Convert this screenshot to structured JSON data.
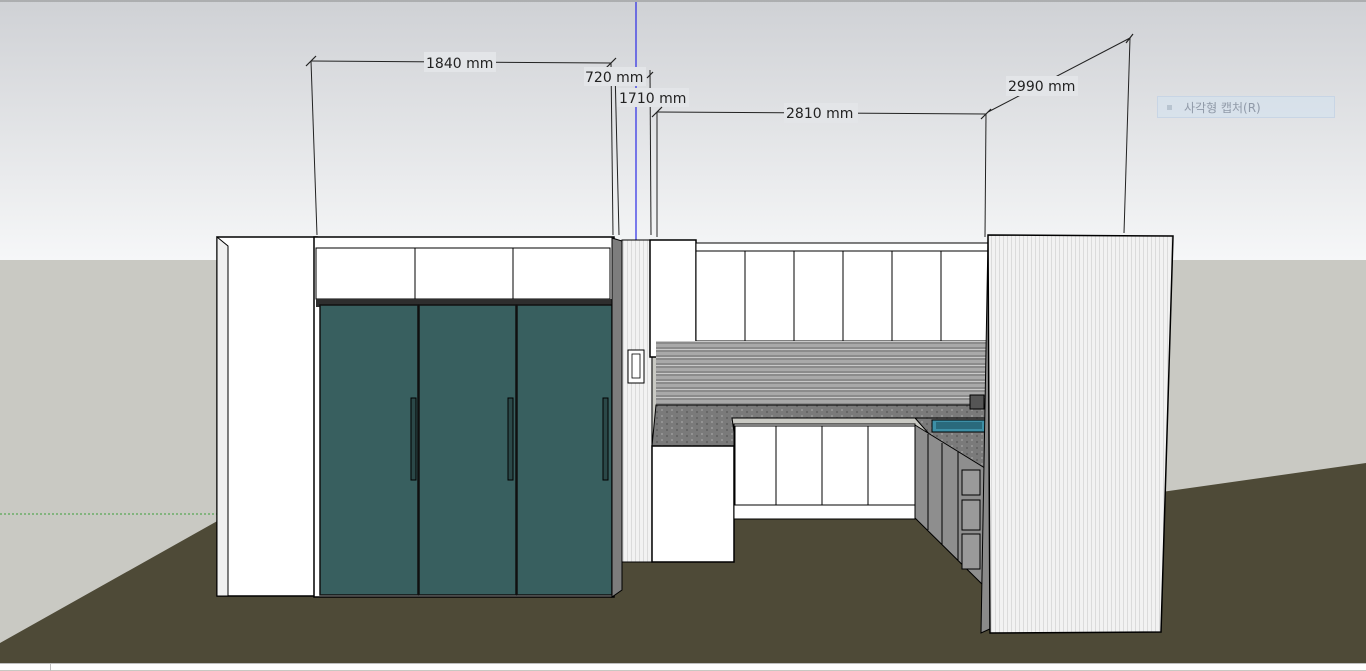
{
  "dimensions": {
    "d1": "1840 mm",
    "d2": "720 mm",
    "d3": "1710 mm",
    "d4": "2810 mm",
    "d5": "2990 mm"
  },
  "overlay": {
    "label": "사각형 캡처(R)"
  },
  "colors": {
    "sky_top": "#d0d2d6",
    "sky_bottom": "#f4f5f6",
    "ground_wall": "#c9c9c3",
    "floor": "#4e4a37",
    "fridge": "#385f5f",
    "cabinet": "#ffffff",
    "blue_axis": "#2a2ae6",
    "green_axis": "#3aa03a"
  }
}
